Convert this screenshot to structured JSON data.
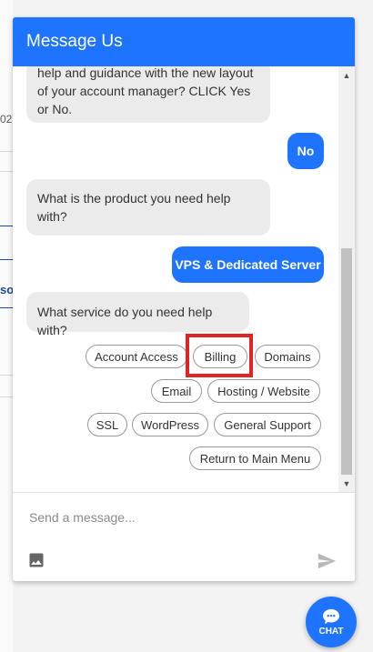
{
  "widget": {
    "title": "Message Us"
  },
  "background": {
    "fragment_text": "02",
    "fragment_bold": "so"
  },
  "messages": {
    "bot_1": "help and guidance with the new layout of your account manager? CLICK Yes or No.",
    "user_1": "No",
    "bot_2": "What is the product you need help with?",
    "user_2": "VPS & Dedicated Server",
    "bot_3": "What service do you need help with?"
  },
  "quick_replies": [
    "Account Access",
    "Billing",
    "Domains",
    "Email",
    "Hosting / Website",
    "SSL",
    "WordPress",
    "General Support",
    "Return to Main Menu"
  ],
  "composer": {
    "placeholder": "Send a message..."
  },
  "chat_button": {
    "label": "CHAT"
  },
  "icons": {
    "image": "image-icon",
    "send": "send-icon",
    "chat": "chat-bubble-icon",
    "scroll_up": "chevron-up-icon",
    "scroll_down": "chevron-down-icon"
  },
  "colors": {
    "brand": "#1f74ff",
    "highlight": "#e02424"
  }
}
